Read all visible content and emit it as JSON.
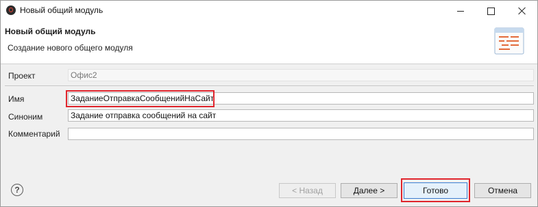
{
  "window": {
    "title": "Новый общий модуль"
  },
  "header": {
    "title": "Новый общий модуль",
    "subtitle": "Создание нового общего модуля"
  },
  "form": {
    "project": {
      "label": "Проект",
      "value": "Офис2"
    },
    "name": {
      "label": "Имя",
      "value": "ЗаданиеОтправкаСообщенийНаСайт"
    },
    "synonym": {
      "label": "Синоним",
      "value": "Задание отправка сообщений на сайт"
    },
    "comment": {
      "label": "Комментарий",
      "value": ""
    }
  },
  "footer": {
    "help_glyph": "?",
    "back_label": "< Назад",
    "next_label": "Далее >",
    "finish_label": "Готово",
    "cancel_label": "Отмена"
  },
  "colors": {
    "highlight": "#e0242c",
    "default_button_border": "#3c7fd1"
  },
  "icons": [
    "app-icon",
    "minimize-icon",
    "maximize-icon",
    "close-icon",
    "common-module-icon",
    "help-icon"
  ]
}
